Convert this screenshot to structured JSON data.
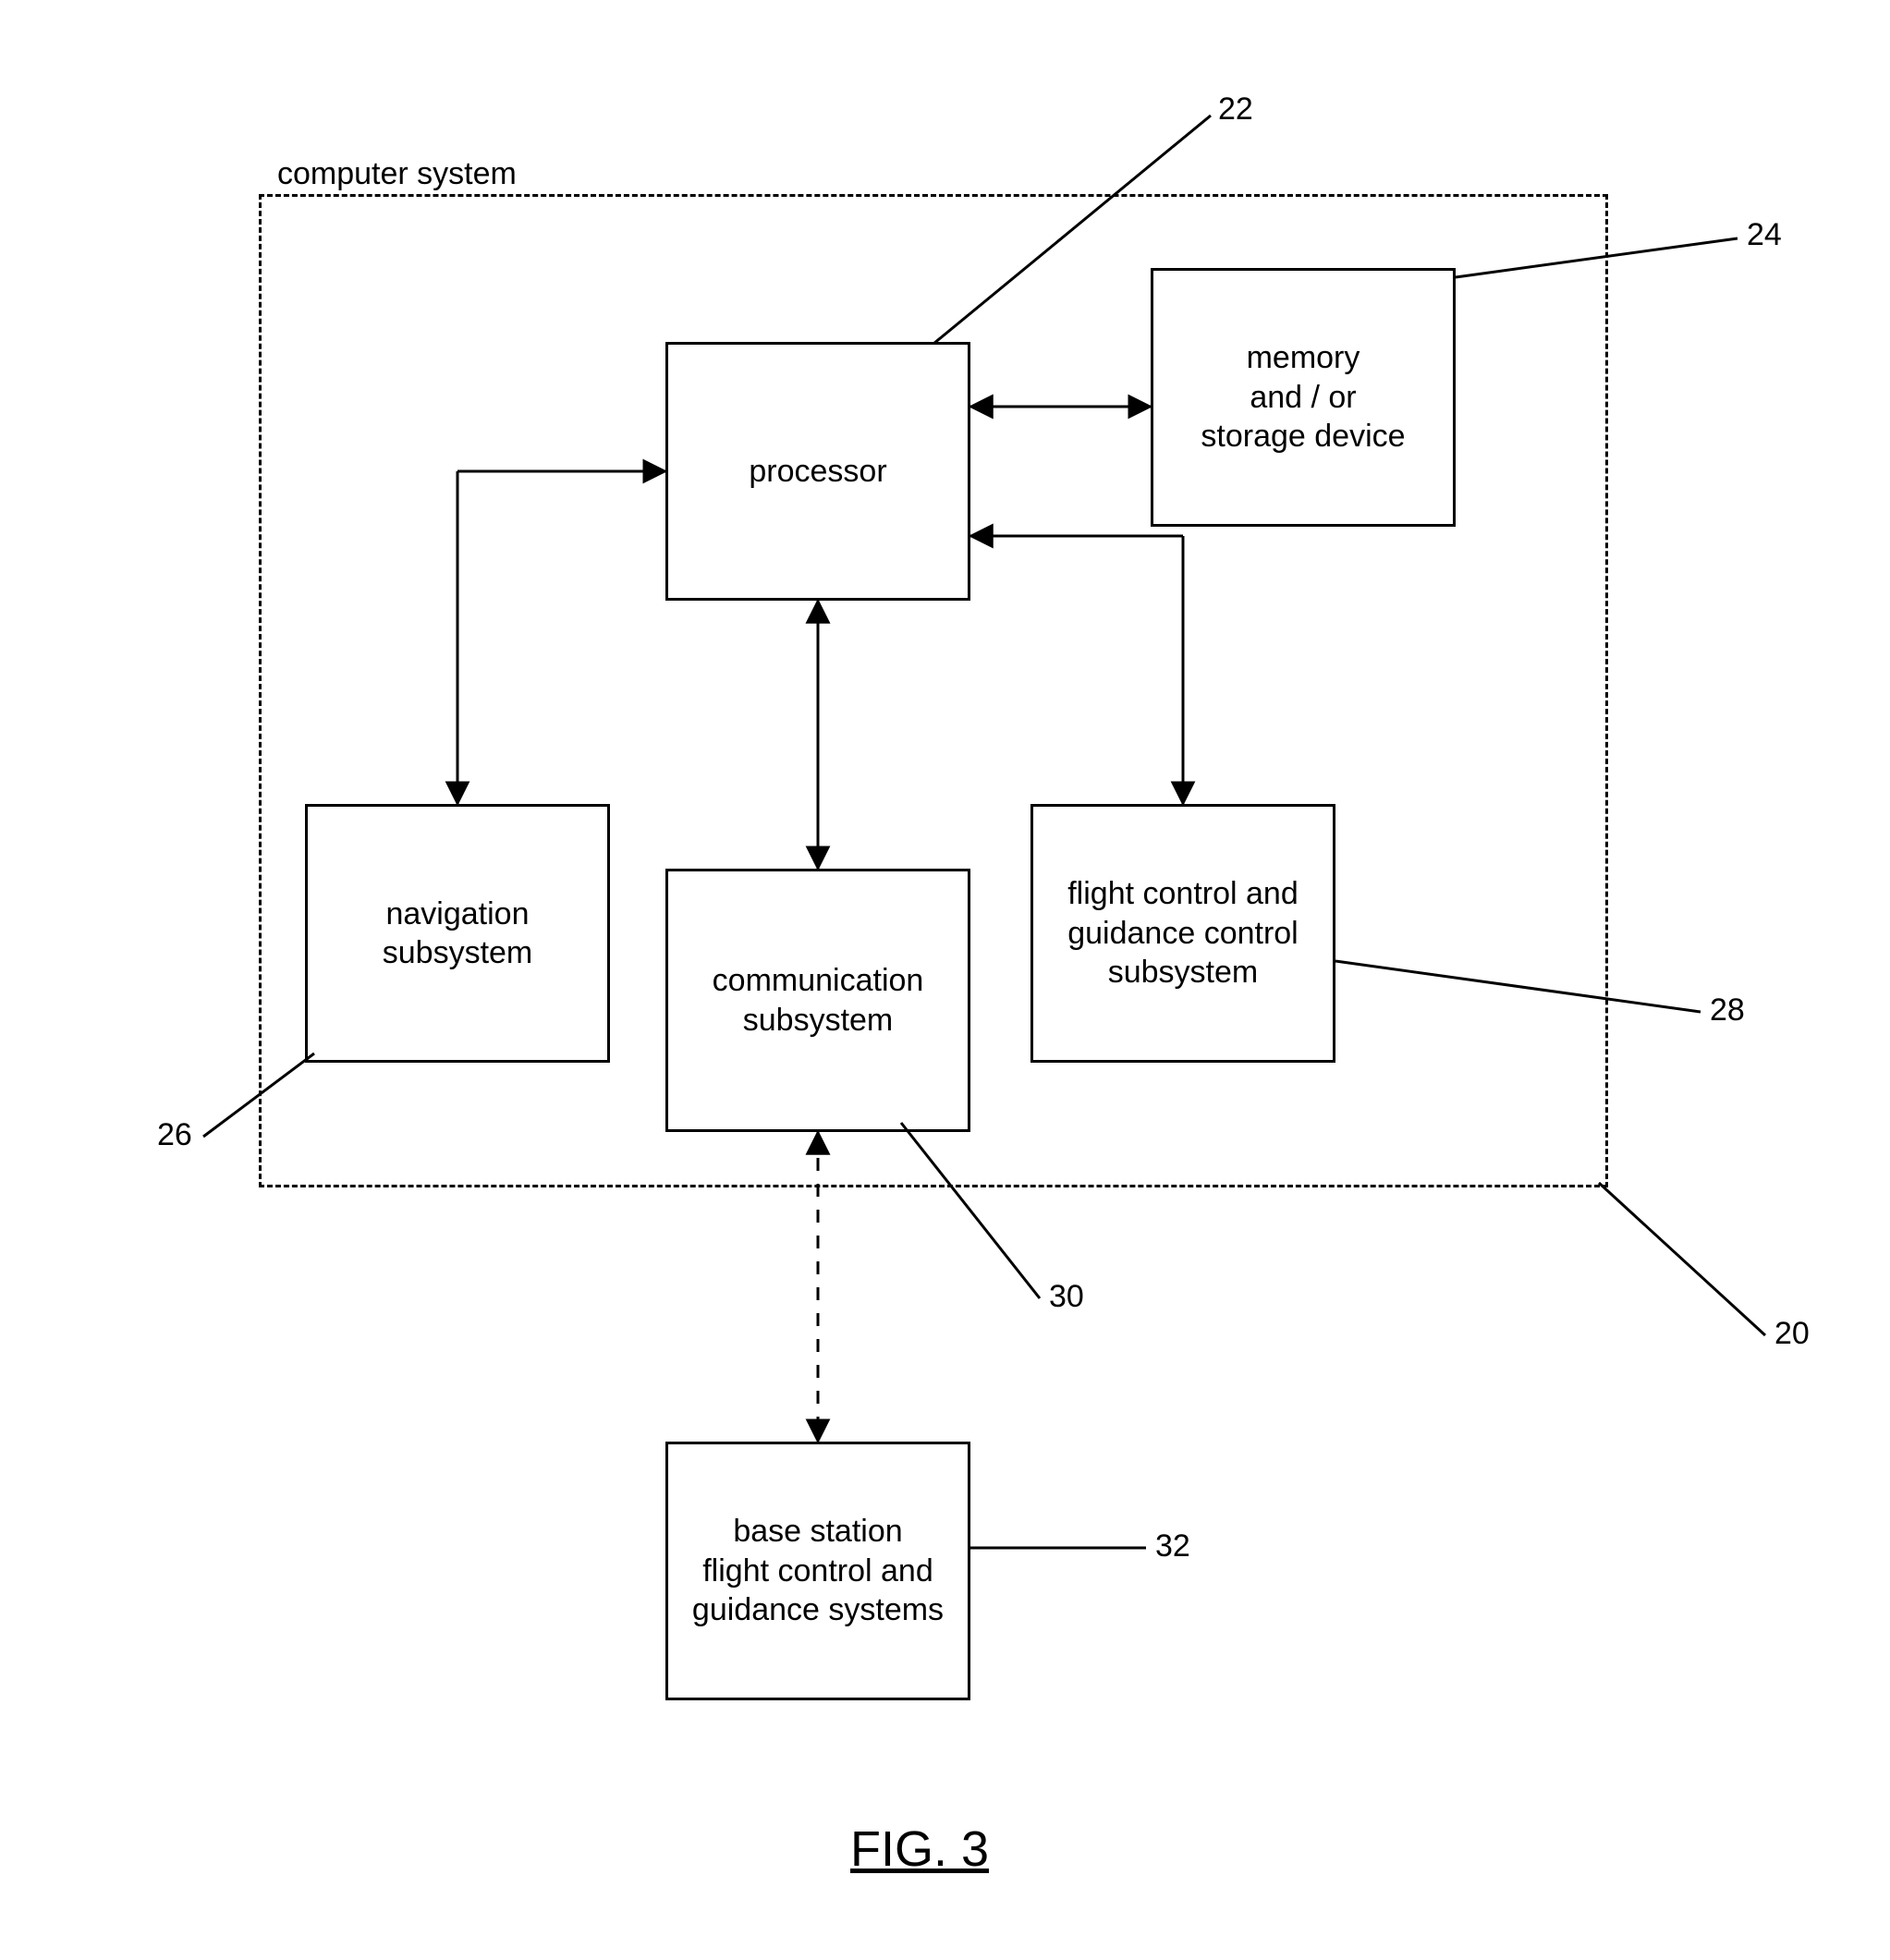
{
  "figure_caption": "FIG. 3",
  "system_box_label": "computer system",
  "boxes": {
    "processor": "processor",
    "memory": "memory\nand / or\nstorage device",
    "navigation": "navigation\nsubsystem",
    "communication": "communication\nsubsystem",
    "flight_control": "flight control and\nguidance control\nsubsystem",
    "base_station": "base station\nflight control and\nguidance systems"
  },
  "reference_numbers": {
    "system": "20",
    "processor": "22",
    "memory": "24",
    "navigation": "26",
    "flight_control": "28",
    "communication": "30",
    "base_station": "32"
  }
}
